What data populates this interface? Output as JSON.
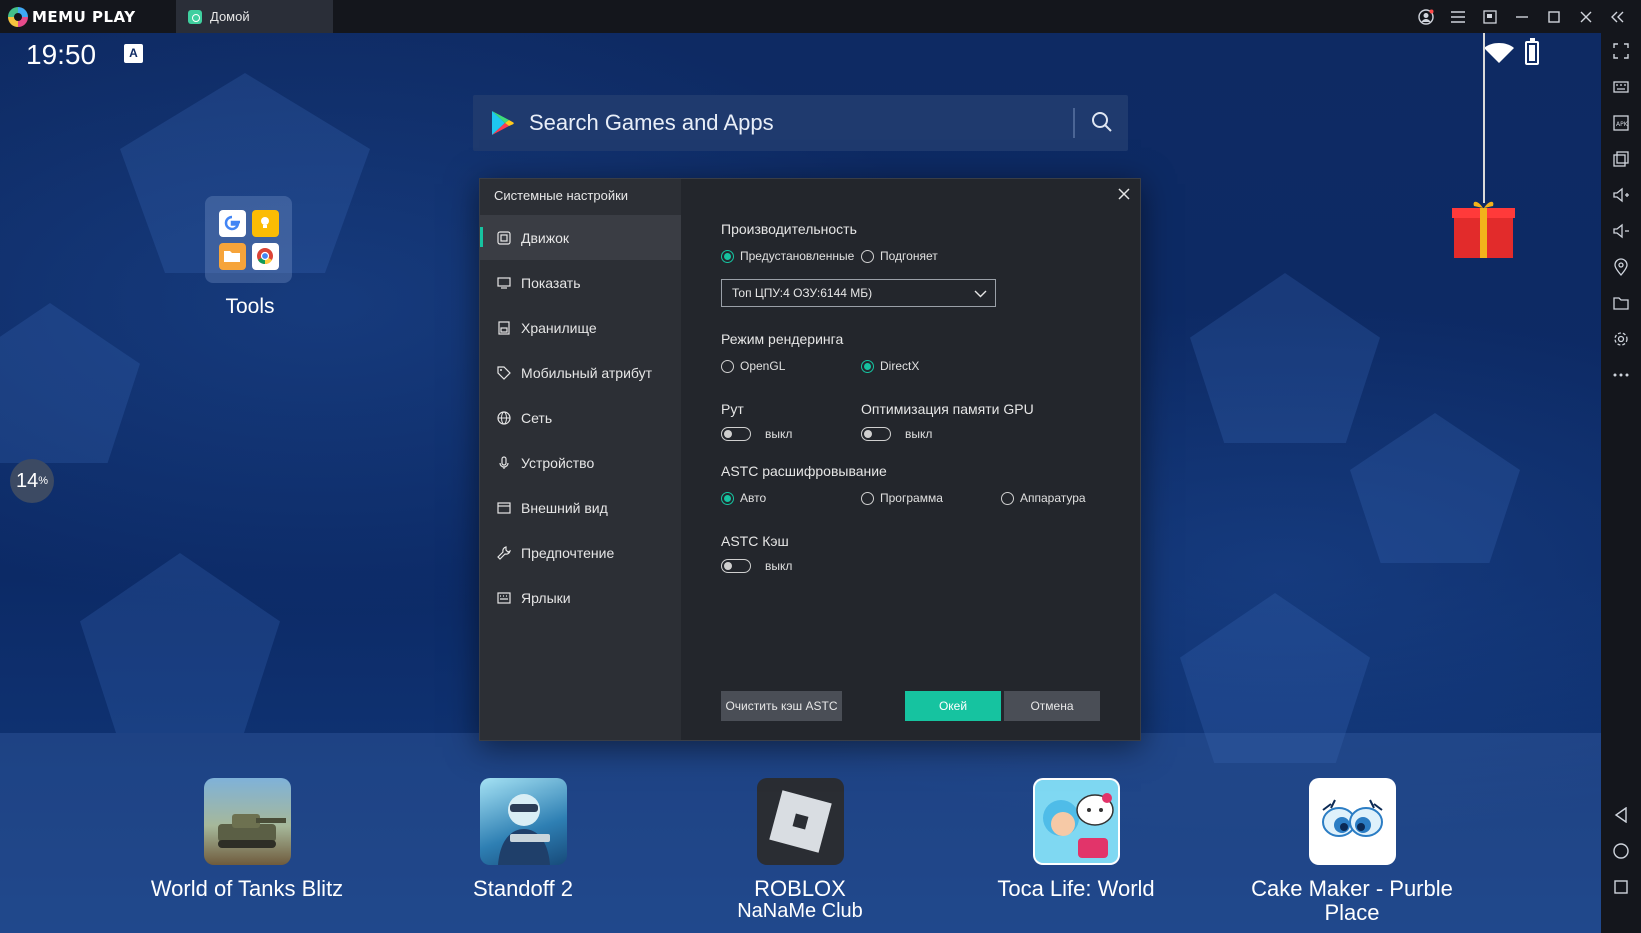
{
  "titlebar": {
    "brand": "MEMU PLAY",
    "tab_label": "Домой"
  },
  "statusbar": {
    "time": "19:50",
    "indicator": "A"
  },
  "search": {
    "placeholder": "Search Games and Apps"
  },
  "home": {
    "folder_label": "Tools",
    "boost_value": "14",
    "boost_unit": "%"
  },
  "dock": {
    "apps": [
      {
        "label": "World of Tanks Blitz",
        "icon": "world-of-tanks-icon"
      },
      {
        "label": "Standoff 2",
        "icon": "standoff-icon"
      },
      {
        "label": "ROBLOX",
        "sublabel": "NaNaMe Club",
        "icon": "roblox-icon"
      },
      {
        "label": "Toca Life: World",
        "icon": "toca-life-icon"
      },
      {
        "label": "Cake Maker - Purble Place",
        "icon": "cake-maker-icon"
      }
    ]
  },
  "dialog": {
    "title": "Системные настройки",
    "nav": [
      {
        "label": "Движок",
        "icon": "engine-icon",
        "active": true
      },
      {
        "label": "Показать",
        "icon": "display-icon"
      },
      {
        "label": "Хранилище",
        "icon": "storage-icon"
      },
      {
        "label": "Мобильный атрибут",
        "icon": "tag-icon"
      },
      {
        "label": "Сеть",
        "icon": "globe-icon"
      },
      {
        "label": "Устройство",
        "icon": "microphone-icon"
      },
      {
        "label": "Внешний вид",
        "icon": "appearance-icon"
      },
      {
        "label": "Предпочтение",
        "icon": "wrench-icon"
      },
      {
        "label": "Ярлыки",
        "icon": "keyboard-icon"
      }
    ],
    "performance": {
      "title": "Производительность",
      "option_preset": "Предустановленные",
      "option_custom": "Подгоняет",
      "selected": "Предустановленные",
      "select_value": "Топ ЦПУ:4 ОЗУ:6144 МБ)"
    },
    "render": {
      "title": "Режим рендеринга",
      "option_opengl": "OpenGL",
      "option_directx": "DirectX",
      "selected": "DirectX"
    },
    "root": {
      "title": "Рут",
      "state": "выкл"
    },
    "gpu_mem": {
      "title": "Оптимизация памяти GPU",
      "state": "выкл"
    },
    "astc_decode": {
      "title": "ASTC расшифровывание",
      "option_auto": "Авто",
      "option_software": "Программа",
      "option_hardware": "Аппаратура",
      "selected": "Авто"
    },
    "astc_cache": {
      "title": "ASTC Кэш",
      "state": "выкл"
    },
    "buttons": {
      "clear": "Очистить кэш ASTC",
      "ok": "Окей",
      "cancel": "Отмена"
    }
  },
  "colors": {
    "accent": "#16c3a0",
    "titlebar": "#14161c",
    "android_bg": "#0e2a63",
    "dialog_bg": "#23262c",
    "dialog_sidebar": "#2c2f35"
  }
}
